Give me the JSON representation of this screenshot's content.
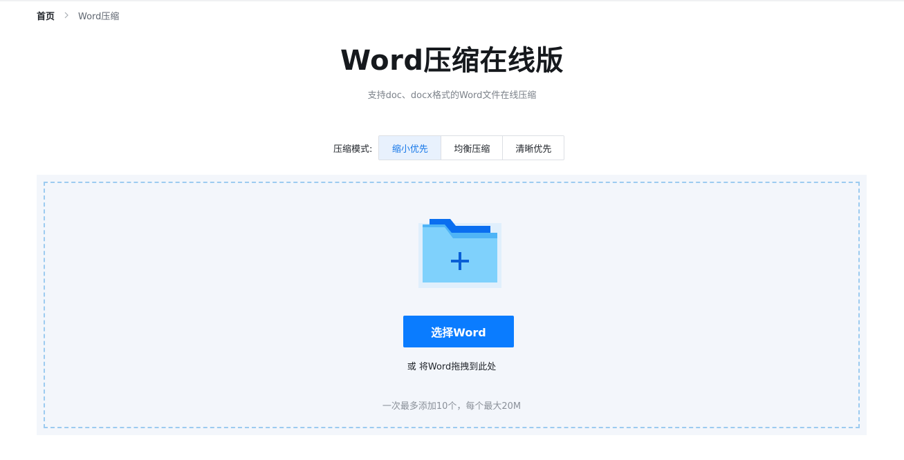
{
  "breadcrumb": {
    "home": "首页",
    "current": "Word压缩"
  },
  "header": {
    "title": "Word压缩在线版",
    "subtitle": "支持doc、docx格式的Word文件在线压缩"
  },
  "compression_mode": {
    "label": "压缩模式:",
    "options": [
      "缩小优先",
      "均衡压缩",
      "清晰优先"
    ],
    "selected": "缩小优先"
  },
  "upload": {
    "icon": "folder-add-icon",
    "button_label": "选择Word",
    "drag_hint": "或 将Word拖拽到此处",
    "limit_hint": "一次最多添加10个，每个最大20M"
  },
  "colors": {
    "accent": "#0a7cff",
    "active_tab_bg": "#e8f1fd",
    "active_tab_text": "#1677e8",
    "dropzone_bg": "#f3f6fb",
    "dropzone_border": "#9ccbf0"
  }
}
